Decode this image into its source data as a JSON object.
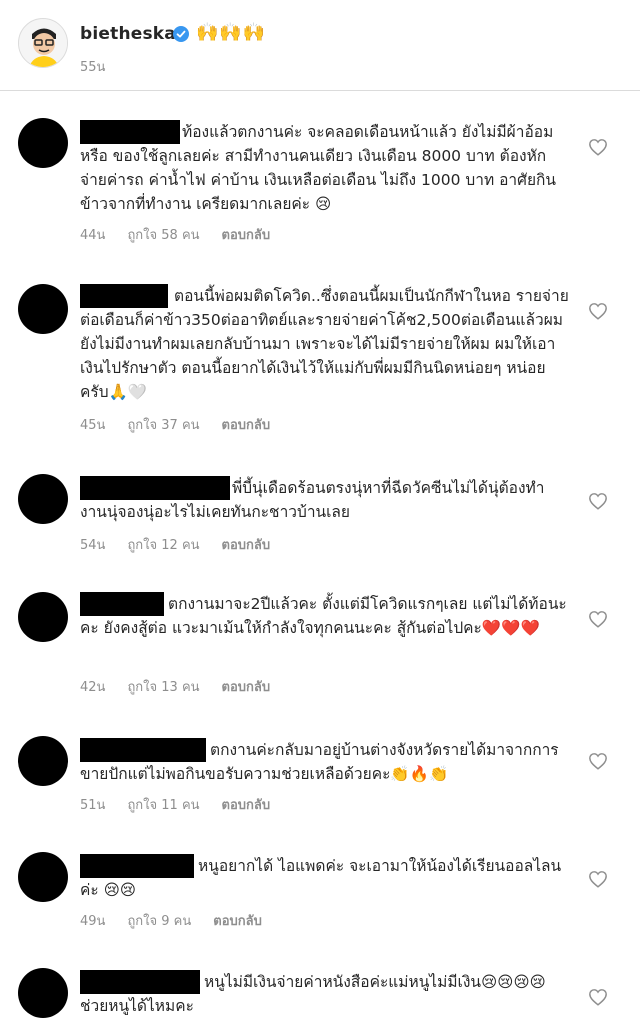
{
  "post": {
    "username": "bietheska",
    "emojis": "🙌🙌🙌",
    "time": "55น"
  },
  "comments": [
    {
      "text": "ท้องแล้วตกงานค่ะ จะคลอดเดือนหน้าแล้ว ยังไม่มีผ้าอ้อม หรือ ของใช้ลูกเลยค่ะ สามีทำงานคนเดียว เงินเดือน 8000 บาท ต้องหักจ่ายค่ารถ ค่าน้ำไฟ ค่าบ้าน เงินเหลือต่อเดือน ไม่ถึง 1000 บาท อาศัยกินข้าวจากที่ทำงาน เครียดมากเลยค่ะ 😢",
      "time": "44น",
      "likes": "ถูกใจ 58 คน",
      "reply": "ตอบกลับ"
    },
    {
      "text": "ตอนนี้พ่อผมติดโควิด..ซึ่งตอนนี้ผมเป็นนักกีฬาในหอ รายจ่ายต่อเดือนก็ค่าข้าว350ต่ออาทิตย์และรายจ่ายค่าโค้ช2,500ต่อเดือนแล้วผมยังไม่มีงานทำผมเลยกลับบ้านมา เพราะจะได้ไม่มีรายจ่ายให้ผม ผมให้เอาเงินไปรักษาตัว  ตอนนี้อยากได้เงินไว้ให้แม่กับพี่ผมมีกินนิดหน่อยๆ หน่อยครับ🙏🤍",
      "time": "45น",
      "likes": "ถูกใจ 37 คน",
      "reply": "ตอบกลับ"
    },
    {
      "text": "พี่บี้นุ่เดือดร้อนตรงนุ่หาที่ฉีดวัคซีนไม่ได้นุ่ต้องทำงานนุ่จองนุ่อะไรไม่เคยทันกะชาวบ้านเลย",
      "time": "54น",
      "likes": "ถูกใจ 12 คน",
      "reply": "ตอบกลับ"
    },
    {
      "text": "ตกงานมาจะ2ปีแล้วคะ ตั้งแต่มีโควิดแรกๆเลย แต่ไม่ได้ท้อนะคะ ยังคงสู้ต่อ แวะมาเม้นให้กำลังใจทุกคนนะคะ สู้กันต่อไปคะ❤️❤️❤️",
      "time": "42น",
      "likes": "ถูกใจ 13 คน",
      "reply": "ตอบกลับ"
    },
    {
      "text": "ตกงานค่ะกลับมาอยู่บ้านต่างจังหวัดรายได้มาจากการขายปักแต่ไม่พอกินขอรับความช่วยเหลือด้วยคะ👏🔥👏",
      "time": "51น",
      "likes": "ถูกใจ 11 คน",
      "reply": "ตอบกลับ"
    },
    {
      "text": "หนูอยากได้ ไอแพดค่ะ จะเอามาให้น้องได้เรียนออลไลนค่ะ 😢😢",
      "time": "49น",
      "likes": "ถูกใจ 9 คน",
      "reply": "ตอบกลับ"
    },
    {
      "text": "หนูไม่มีเงินจ่ายค่าหนังสือค่ะแม่หนูไม่มีเงิน😢😢😢😢ช่วยหนูได้ไหมคะ",
      "time": "",
      "likes": "",
      "reply": ""
    }
  ]
}
